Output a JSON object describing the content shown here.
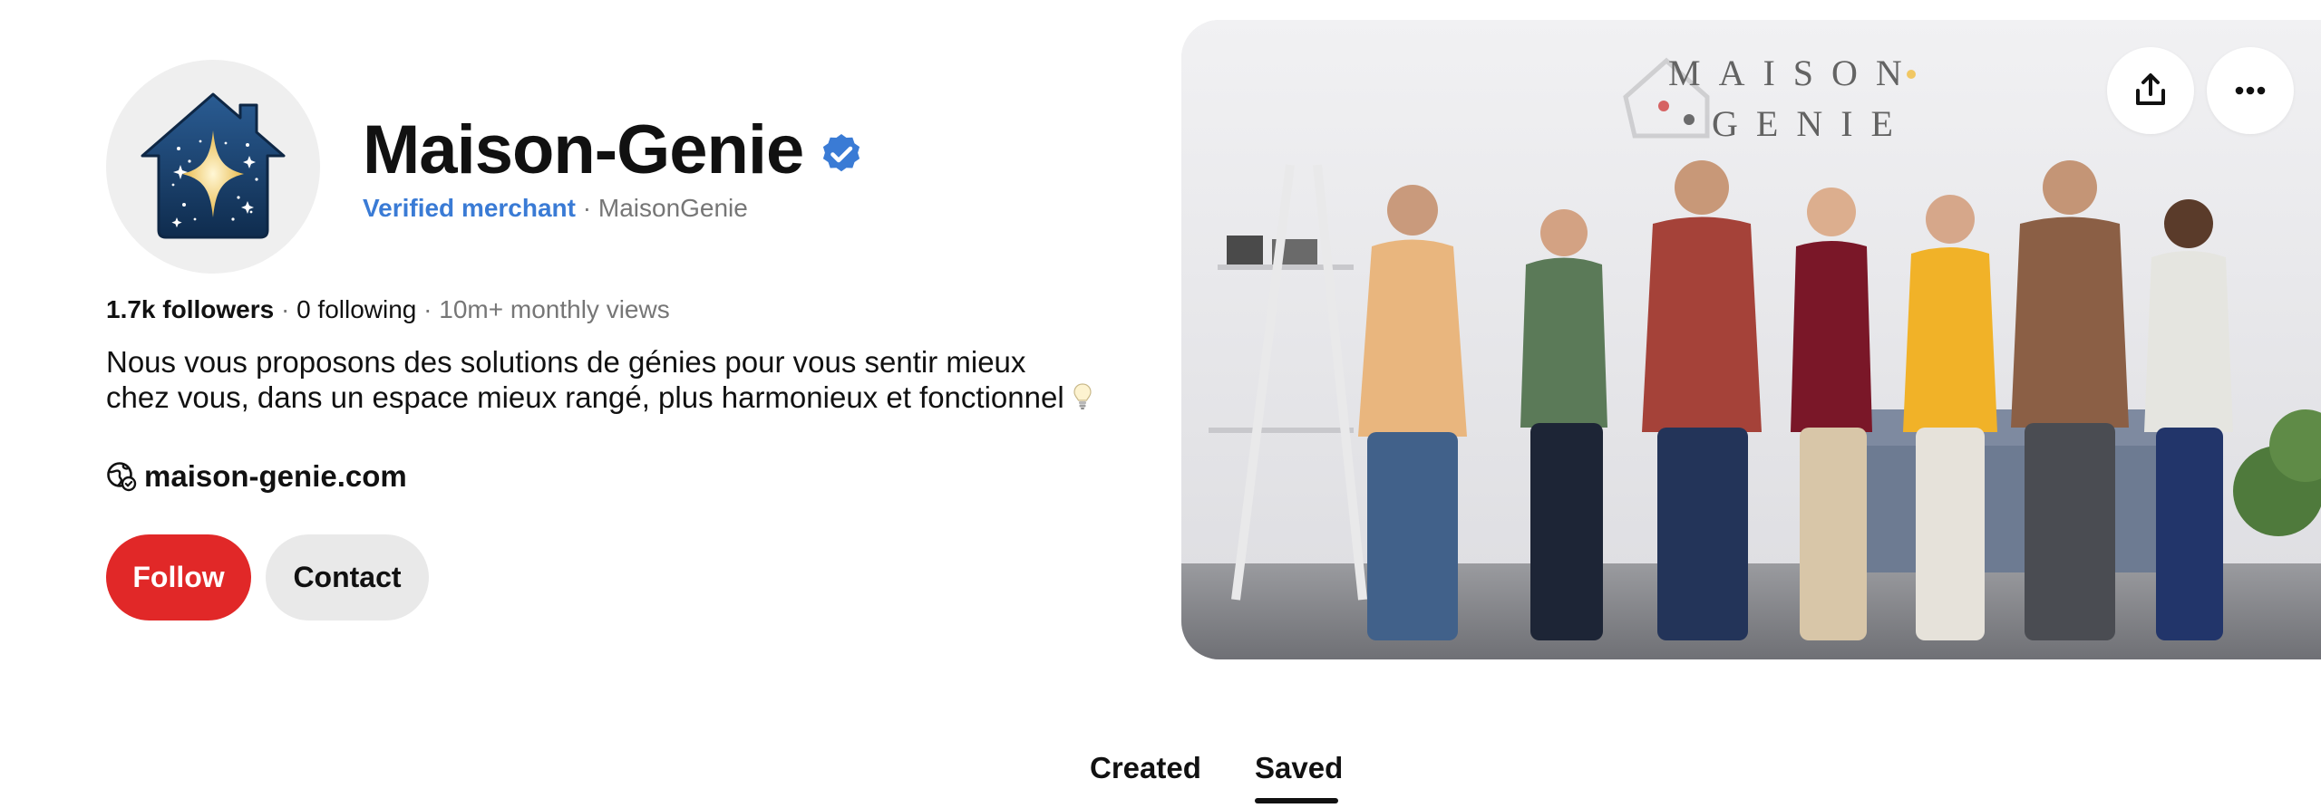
{
  "profile": {
    "name": "Maison-Genie",
    "verified_label": "Verified merchant",
    "separator": " · ",
    "username": "MaisonGenie",
    "stats": {
      "followers": "1.7k followers",
      "following": "0 following",
      "views": "10m+ monthly views"
    },
    "bio": "Nous vous proposons des solutions de génies pour vous sentir mieux chez vous, dans un espace mieux rangé, plus harmonieux et fonctionnel",
    "website": "maison-genie.com"
  },
  "actions": {
    "follow_label": "Follow",
    "contact_label": "Contact"
  },
  "cover": {
    "logo_line1": "MAISON",
    "logo_line2": "GENIE"
  },
  "tabs": [
    {
      "label": "Created",
      "active": false
    },
    {
      "label": "Saved",
      "active": true
    }
  ],
  "icons": {
    "avatar": "house-star-logo",
    "verified": "verified-check-icon",
    "bulb": "lightbulb-emoji",
    "globe": "globe-icon",
    "share": "share-icon",
    "more": "more-dots-icon"
  },
  "colors": {
    "follow_button": "#e12828",
    "contact_button": "#e9e9e9",
    "verified_blue": "#3a7bd5",
    "secondary_text": "#767676"
  }
}
